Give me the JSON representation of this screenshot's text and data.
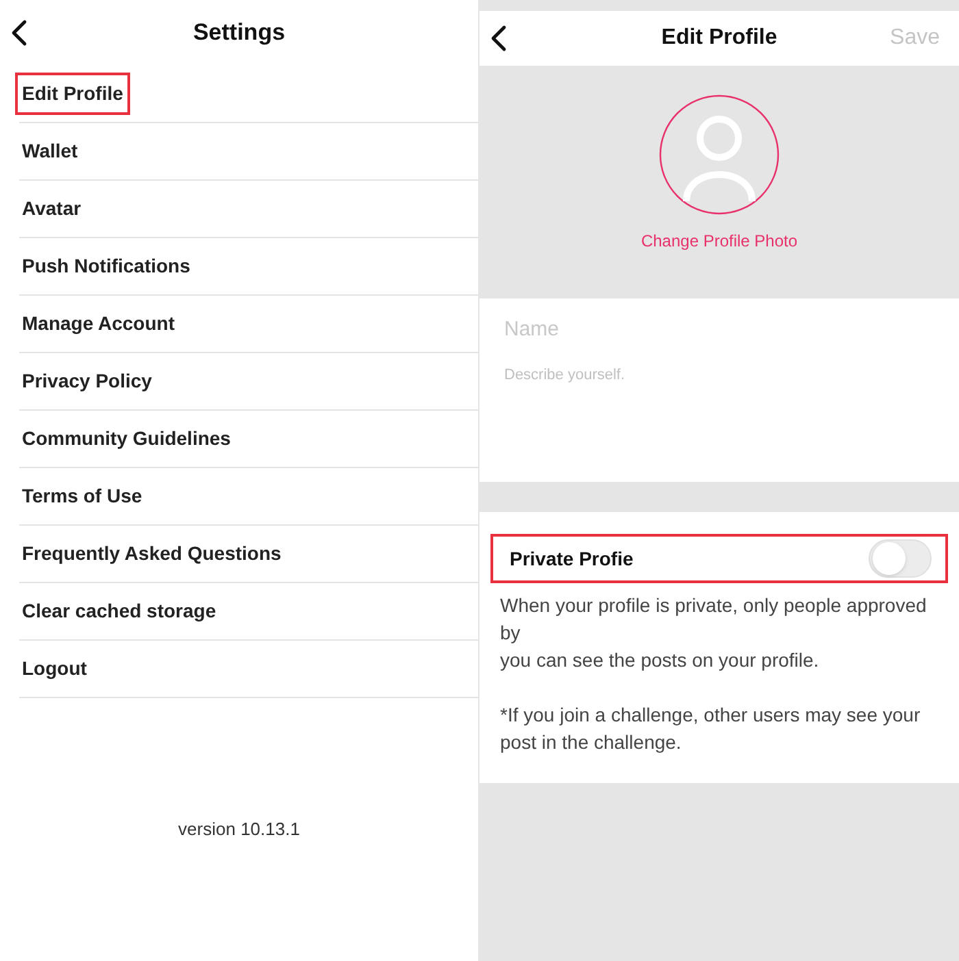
{
  "settings": {
    "title": "Settings",
    "items": [
      {
        "label": "Edit Profile",
        "highlighted": true
      },
      {
        "label": "Wallet",
        "highlighted": false
      },
      {
        "label": "Avatar",
        "highlighted": false
      },
      {
        "label": "Push Notifications",
        "highlighted": false
      },
      {
        "label": "Manage Account",
        "highlighted": false
      },
      {
        "label": "Privacy Policy",
        "highlighted": false
      },
      {
        "label": "Community Guidelines",
        "highlighted": false
      },
      {
        "label": "Terms of Use",
        "highlighted": false
      },
      {
        "label": "Frequently Asked Questions",
        "highlighted": false
      },
      {
        "label": "Clear cached storage",
        "highlighted": false
      },
      {
        "label": "Logout",
        "highlighted": false
      }
    ],
    "version": "version 10.13.1"
  },
  "edit_profile": {
    "title": "Edit Profile",
    "save": "Save",
    "change_photo": "Change Profile Photo",
    "name_placeholder": "Name",
    "bio_placeholder": "Describe yourself.",
    "private_profile": {
      "label": "Private Profie",
      "on": false,
      "highlighted": true
    },
    "notes": [
      "When your profile is private, only people approved by\nyou can see the posts on your profile.",
      "*If you join a challenge, other users may see your post in the challenge."
    ]
  }
}
